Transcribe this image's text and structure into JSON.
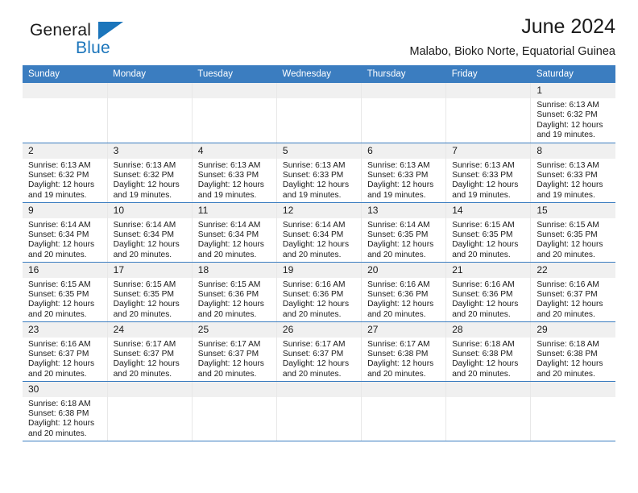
{
  "brand": {
    "name_top": "General",
    "name_bottom": "Blue",
    "accent_color": "#1b75bb",
    "triangle_icon": "triangle-icon"
  },
  "header": {
    "title": "June 2024",
    "subtitle": "Malabo, Bioko Norte, Equatorial Guinea"
  },
  "theme": {
    "header_row_bg": "#3b7dc0",
    "day_strip_bg": "#f0f0f0",
    "row_divider": "#3b7dc0",
    "cell_divider": "#e8e8e8",
    "text": "#1a1a1a"
  },
  "weekdays": [
    "Sunday",
    "Monday",
    "Tuesday",
    "Wednesday",
    "Thursday",
    "Friday",
    "Saturday"
  ],
  "labels": {
    "sunrise_prefix": "Sunrise:",
    "sunset_prefix": "Sunset:",
    "daylight_prefix": "Daylight:"
  },
  "weeks": [
    [
      {
        "day": "",
        "empty": true
      },
      {
        "day": "",
        "empty": true
      },
      {
        "day": "",
        "empty": true
      },
      {
        "day": "",
        "empty": true
      },
      {
        "day": "",
        "empty": true
      },
      {
        "day": "",
        "empty": true
      },
      {
        "day": "1",
        "sunrise": "Sunrise: 6:13 AM",
        "sunset": "Sunset: 6:32 PM",
        "daylight_1": "Daylight: 12 hours",
        "daylight_2": "and 19 minutes."
      }
    ],
    [
      {
        "day": "2",
        "sunrise": "Sunrise: 6:13 AM",
        "sunset": "Sunset: 6:32 PM",
        "daylight_1": "Daylight: 12 hours",
        "daylight_2": "and 19 minutes."
      },
      {
        "day": "3",
        "sunrise": "Sunrise: 6:13 AM",
        "sunset": "Sunset: 6:32 PM",
        "daylight_1": "Daylight: 12 hours",
        "daylight_2": "and 19 minutes."
      },
      {
        "day": "4",
        "sunrise": "Sunrise: 6:13 AM",
        "sunset": "Sunset: 6:33 PM",
        "daylight_1": "Daylight: 12 hours",
        "daylight_2": "and 19 minutes."
      },
      {
        "day": "5",
        "sunrise": "Sunrise: 6:13 AM",
        "sunset": "Sunset: 6:33 PM",
        "daylight_1": "Daylight: 12 hours",
        "daylight_2": "and 19 minutes."
      },
      {
        "day": "6",
        "sunrise": "Sunrise: 6:13 AM",
        "sunset": "Sunset: 6:33 PM",
        "daylight_1": "Daylight: 12 hours",
        "daylight_2": "and 19 minutes."
      },
      {
        "day": "7",
        "sunrise": "Sunrise: 6:13 AM",
        "sunset": "Sunset: 6:33 PM",
        "daylight_1": "Daylight: 12 hours",
        "daylight_2": "and 19 minutes."
      },
      {
        "day": "8",
        "sunrise": "Sunrise: 6:13 AM",
        "sunset": "Sunset: 6:33 PM",
        "daylight_1": "Daylight: 12 hours",
        "daylight_2": "and 19 minutes."
      }
    ],
    [
      {
        "day": "9",
        "sunrise": "Sunrise: 6:14 AM",
        "sunset": "Sunset: 6:34 PM",
        "daylight_1": "Daylight: 12 hours",
        "daylight_2": "and 20 minutes."
      },
      {
        "day": "10",
        "sunrise": "Sunrise: 6:14 AM",
        "sunset": "Sunset: 6:34 PM",
        "daylight_1": "Daylight: 12 hours",
        "daylight_2": "and 20 minutes."
      },
      {
        "day": "11",
        "sunrise": "Sunrise: 6:14 AM",
        "sunset": "Sunset: 6:34 PM",
        "daylight_1": "Daylight: 12 hours",
        "daylight_2": "and 20 minutes."
      },
      {
        "day": "12",
        "sunrise": "Sunrise: 6:14 AM",
        "sunset": "Sunset: 6:34 PM",
        "daylight_1": "Daylight: 12 hours",
        "daylight_2": "and 20 minutes."
      },
      {
        "day": "13",
        "sunrise": "Sunrise: 6:14 AM",
        "sunset": "Sunset: 6:35 PM",
        "daylight_1": "Daylight: 12 hours",
        "daylight_2": "and 20 minutes."
      },
      {
        "day": "14",
        "sunrise": "Sunrise: 6:15 AM",
        "sunset": "Sunset: 6:35 PM",
        "daylight_1": "Daylight: 12 hours",
        "daylight_2": "and 20 minutes."
      },
      {
        "day": "15",
        "sunrise": "Sunrise: 6:15 AM",
        "sunset": "Sunset: 6:35 PM",
        "daylight_1": "Daylight: 12 hours",
        "daylight_2": "and 20 minutes."
      }
    ],
    [
      {
        "day": "16",
        "sunrise": "Sunrise: 6:15 AM",
        "sunset": "Sunset: 6:35 PM",
        "daylight_1": "Daylight: 12 hours",
        "daylight_2": "and 20 minutes."
      },
      {
        "day": "17",
        "sunrise": "Sunrise: 6:15 AM",
        "sunset": "Sunset: 6:35 PM",
        "daylight_1": "Daylight: 12 hours",
        "daylight_2": "and 20 minutes."
      },
      {
        "day": "18",
        "sunrise": "Sunrise: 6:15 AM",
        "sunset": "Sunset: 6:36 PM",
        "daylight_1": "Daylight: 12 hours",
        "daylight_2": "and 20 minutes."
      },
      {
        "day": "19",
        "sunrise": "Sunrise: 6:16 AM",
        "sunset": "Sunset: 6:36 PM",
        "daylight_1": "Daylight: 12 hours",
        "daylight_2": "and 20 minutes."
      },
      {
        "day": "20",
        "sunrise": "Sunrise: 6:16 AM",
        "sunset": "Sunset: 6:36 PM",
        "daylight_1": "Daylight: 12 hours",
        "daylight_2": "and 20 minutes."
      },
      {
        "day": "21",
        "sunrise": "Sunrise: 6:16 AM",
        "sunset": "Sunset: 6:36 PM",
        "daylight_1": "Daylight: 12 hours",
        "daylight_2": "and 20 minutes."
      },
      {
        "day": "22",
        "sunrise": "Sunrise: 6:16 AM",
        "sunset": "Sunset: 6:37 PM",
        "daylight_1": "Daylight: 12 hours",
        "daylight_2": "and 20 minutes."
      }
    ],
    [
      {
        "day": "23",
        "sunrise": "Sunrise: 6:16 AM",
        "sunset": "Sunset: 6:37 PM",
        "daylight_1": "Daylight: 12 hours",
        "daylight_2": "and 20 minutes."
      },
      {
        "day": "24",
        "sunrise": "Sunrise: 6:17 AM",
        "sunset": "Sunset: 6:37 PM",
        "daylight_1": "Daylight: 12 hours",
        "daylight_2": "and 20 minutes."
      },
      {
        "day": "25",
        "sunrise": "Sunrise: 6:17 AM",
        "sunset": "Sunset: 6:37 PM",
        "daylight_1": "Daylight: 12 hours",
        "daylight_2": "and 20 minutes."
      },
      {
        "day": "26",
        "sunrise": "Sunrise: 6:17 AM",
        "sunset": "Sunset: 6:37 PM",
        "daylight_1": "Daylight: 12 hours",
        "daylight_2": "and 20 minutes."
      },
      {
        "day": "27",
        "sunrise": "Sunrise: 6:17 AM",
        "sunset": "Sunset: 6:38 PM",
        "daylight_1": "Daylight: 12 hours",
        "daylight_2": "and 20 minutes."
      },
      {
        "day": "28",
        "sunrise": "Sunrise: 6:18 AM",
        "sunset": "Sunset: 6:38 PM",
        "daylight_1": "Daylight: 12 hours",
        "daylight_2": "and 20 minutes."
      },
      {
        "day": "29",
        "sunrise": "Sunrise: 6:18 AM",
        "sunset": "Sunset: 6:38 PM",
        "daylight_1": "Daylight: 12 hours",
        "daylight_2": "and 20 minutes."
      }
    ],
    [
      {
        "day": "30",
        "sunrise": "Sunrise: 6:18 AM",
        "sunset": "Sunset: 6:38 PM",
        "daylight_1": "Daylight: 12 hours",
        "daylight_2": "and 20 minutes."
      },
      {
        "day": "",
        "empty": true
      },
      {
        "day": "",
        "empty": true
      },
      {
        "day": "",
        "empty": true
      },
      {
        "day": "",
        "empty": true
      },
      {
        "day": "",
        "empty": true
      },
      {
        "day": "",
        "empty": true
      }
    ]
  ]
}
